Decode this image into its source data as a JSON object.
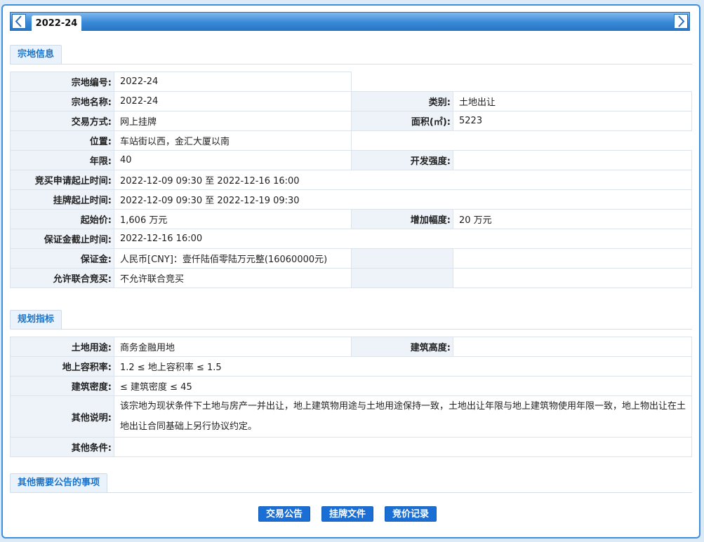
{
  "tab": {
    "label": "2022-24"
  },
  "sections": {
    "parcel_info": "宗地信息",
    "planning": "规划指标",
    "other_notice": "其他需要公告的事项"
  },
  "parcel": {
    "number_label": "宗地编号:",
    "number": "2022-24",
    "name_label": "宗地名称:",
    "name": "2022-24",
    "category_label": "类别:",
    "category": "土地出让",
    "method_label": "交易方式:",
    "method": "网上挂牌",
    "area_label": "面积(㎡):",
    "area": "5223",
    "location_label": "位置:",
    "location": "车站街以西，金汇大厦以南",
    "term_label": "年限:",
    "term": "40",
    "intensity_label": "开发强度:",
    "intensity": "",
    "bid_apply_label": "竞买申请起止时间:",
    "bid_apply": "2022-12-09 09:30 至 2022-12-16 16:00",
    "listing_label": "挂牌起止时间:",
    "listing": "2022-12-09 09:30 至 2022-12-19 09:30",
    "start_price_label": "起始价:",
    "start_price": "1,606 万元",
    "increment_label": "增加幅度:",
    "increment": "20 万元",
    "deposit_deadline_label": "保证金截止时间:",
    "deposit_deadline": "2022-12-16 16:00",
    "deposit_label": "保证金:",
    "deposit": "人民币[CNY]：壹仟陆佰零陆万元整(16060000元)",
    "joint_label": "允许联合竞买:",
    "joint": "不允许联合竞买"
  },
  "planning": {
    "use_label": "土地用途:",
    "use": "商务金融用地",
    "height_label": "建筑高度:",
    "height": "",
    "far_label": "地上容积率:",
    "far": "1.2 ≤ 地上容积率 ≤ 1.5",
    "density_label": "建筑密度:",
    "density": "≤ 建筑密度 ≤ 45",
    "other_desc_label": "其他说明:",
    "other_desc": "该宗地为现状条件下土地与房产一并出让，地上建筑物用途与土地用途保持一致，土地出让年限与地上建筑物使用年限一致，地上物出让在土地出让合同基础上另行协议约定。",
    "other_cond_label": "其他条件:",
    "other_cond": ""
  },
  "buttons": {
    "announcement": "交易公告",
    "listing_docs": "挂牌文件",
    "bid_records": "竞价记录"
  },
  "colors": {
    "accent": "#1a6ed4",
    "header_bg": "#eef3fa",
    "tabbar": "#3a8ad8"
  }
}
